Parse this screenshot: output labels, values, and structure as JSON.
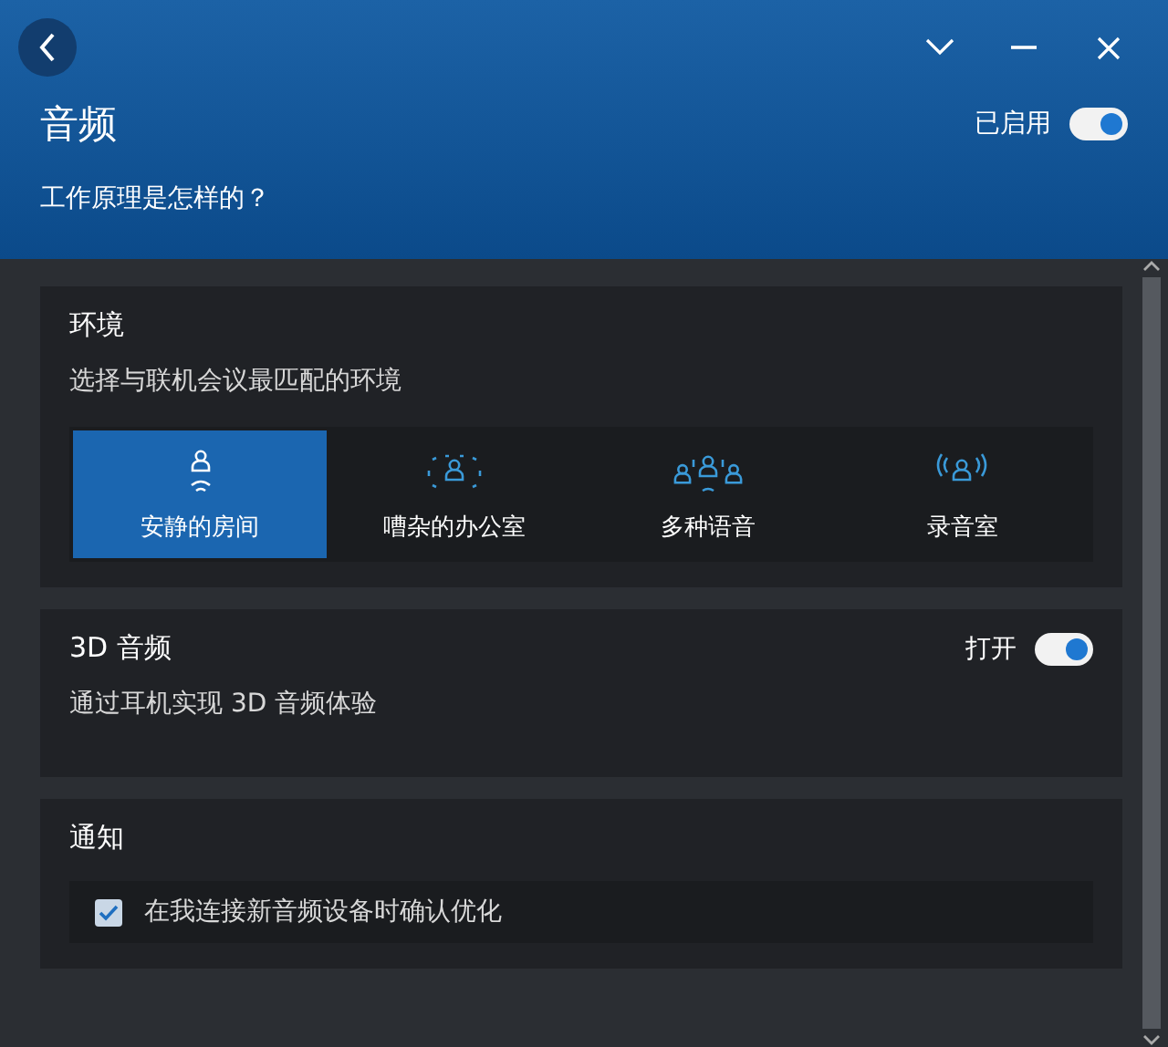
{
  "header": {
    "title": "音频",
    "status": "已启用",
    "enabled": true,
    "link": "工作原理是怎样的？"
  },
  "environment": {
    "title": "环境",
    "description": "选择与联机会议最匹配的环境",
    "options": [
      {
        "label": "安静的房间",
        "kind": "quiet",
        "selected": true
      },
      {
        "label": "嘈杂的办公室",
        "kind": "noisy",
        "selected": false
      },
      {
        "label": "多种语音",
        "kind": "multi",
        "selected": false
      },
      {
        "label": "录音室",
        "kind": "studio",
        "selected": false
      }
    ]
  },
  "audio3d": {
    "title": "3D 音频",
    "status": "打开",
    "on": true,
    "description": "通过耳机实现 3D 音频体验"
  },
  "notifications": {
    "title": "通知",
    "items": [
      {
        "label": "在我连接新音频设备时确认优化",
        "checked": true
      }
    ]
  }
}
